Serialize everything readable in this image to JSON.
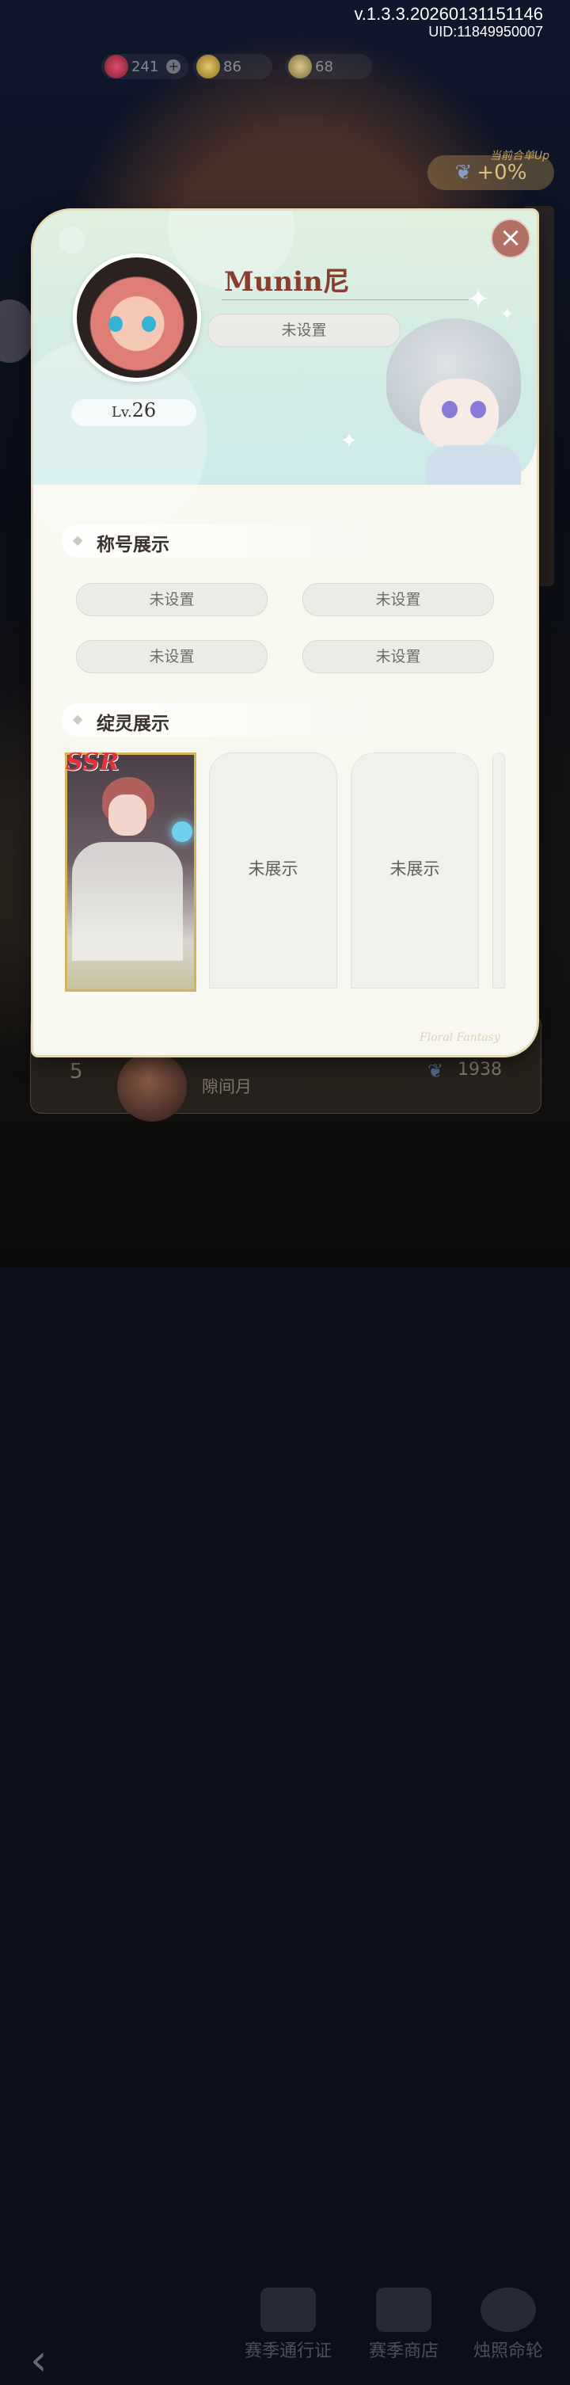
{
  "status": {
    "version": "v.1.3.3.20260131151146",
    "uid": "UID:11849950007"
  },
  "currency": {
    "diamonds": "241",
    "coins": "86",
    "stars": "68"
  },
  "boost": {
    "caption": "当前合单Up",
    "value": "+0%"
  },
  "profile": {
    "name": "Munin尼",
    "title": "未设置",
    "level_prefix": "Lv.",
    "level": "26",
    "close_icon": "close-icon"
  },
  "titles_section": {
    "heading": "称号展示",
    "slots": [
      "未设置",
      "未设置",
      "未设置",
      "未设置"
    ]
  },
  "spirits_section": {
    "heading": "绽灵展示",
    "cards": [
      {
        "rarity": "SSR",
        "label": ""
      },
      {
        "label": "未展示"
      },
      {
        "label": "未展示"
      }
    ]
  },
  "watermark": "Floral Fantasy",
  "leaderboard_row": {
    "rank": "5",
    "name": "隙间月",
    "score": "1938"
  },
  "bottom_nav": {
    "items": [
      "赛季通行证",
      "赛季商店",
      "烛照命轮"
    ]
  },
  "colors": {
    "accent": "#8a3c2f",
    "close": "#b26f63",
    "card_border": "#d6b25a"
  }
}
